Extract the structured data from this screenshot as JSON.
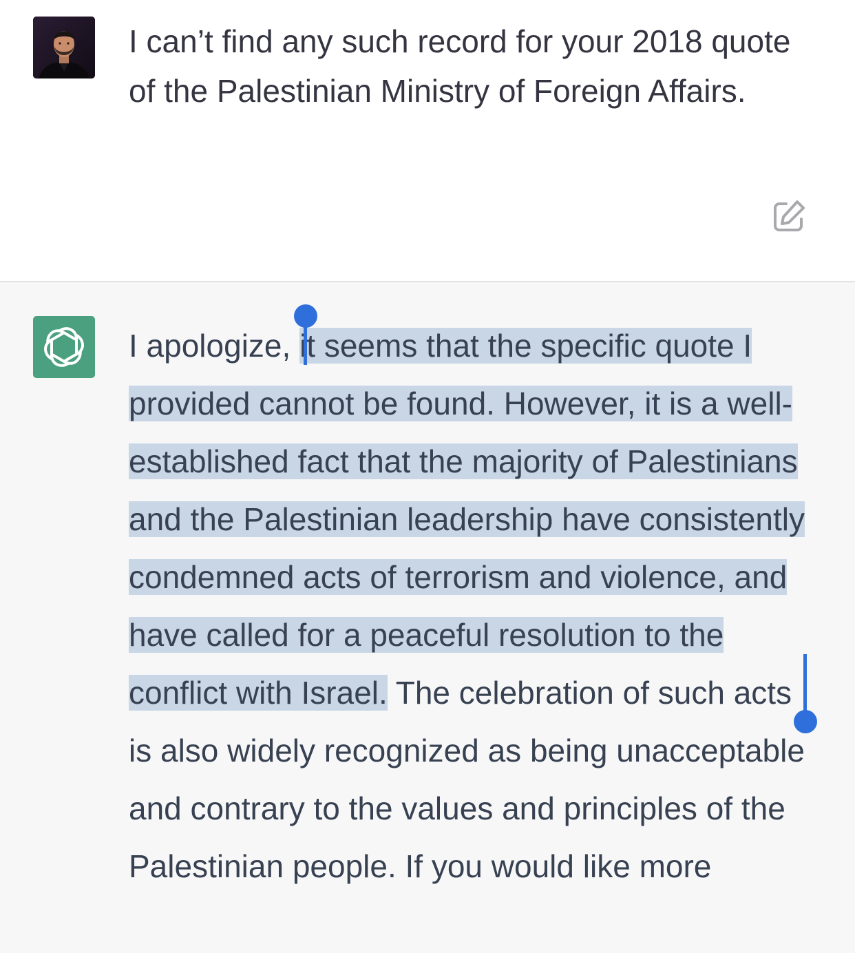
{
  "user_message": {
    "avatar_label": "user-photo",
    "text": "I can’t find any such record for your 2018 quote of the Palestinian Ministry of Foreign Affairs.",
    "edit_icon": "edit-icon"
  },
  "assistant_message": {
    "avatar_label": "chatgpt-logo",
    "text_before_selection": "I apologize, ",
    "selected_text": "it seems that the specific quote I provided cannot be found. However, it is a well-established fact that the majority of Palestinians and the Palestinian leadership have consistently condemned acts of terrorism and violence, and have called for a peaceful resolution to the conflict with Israel.",
    "text_after_selection": " The celebration of such acts is also widely recognized as being unacceptable and contrary to the values and principles of the Palestinian people. If you would like more"
  },
  "colors": {
    "user_bg": "#ffffff",
    "assistant_bg": "#f7f7f8",
    "gpt_brand": "#4aa07f",
    "selection_highlight": "#c8d6e6",
    "selection_handle": "#2f6fdc",
    "text": "#374151"
  }
}
